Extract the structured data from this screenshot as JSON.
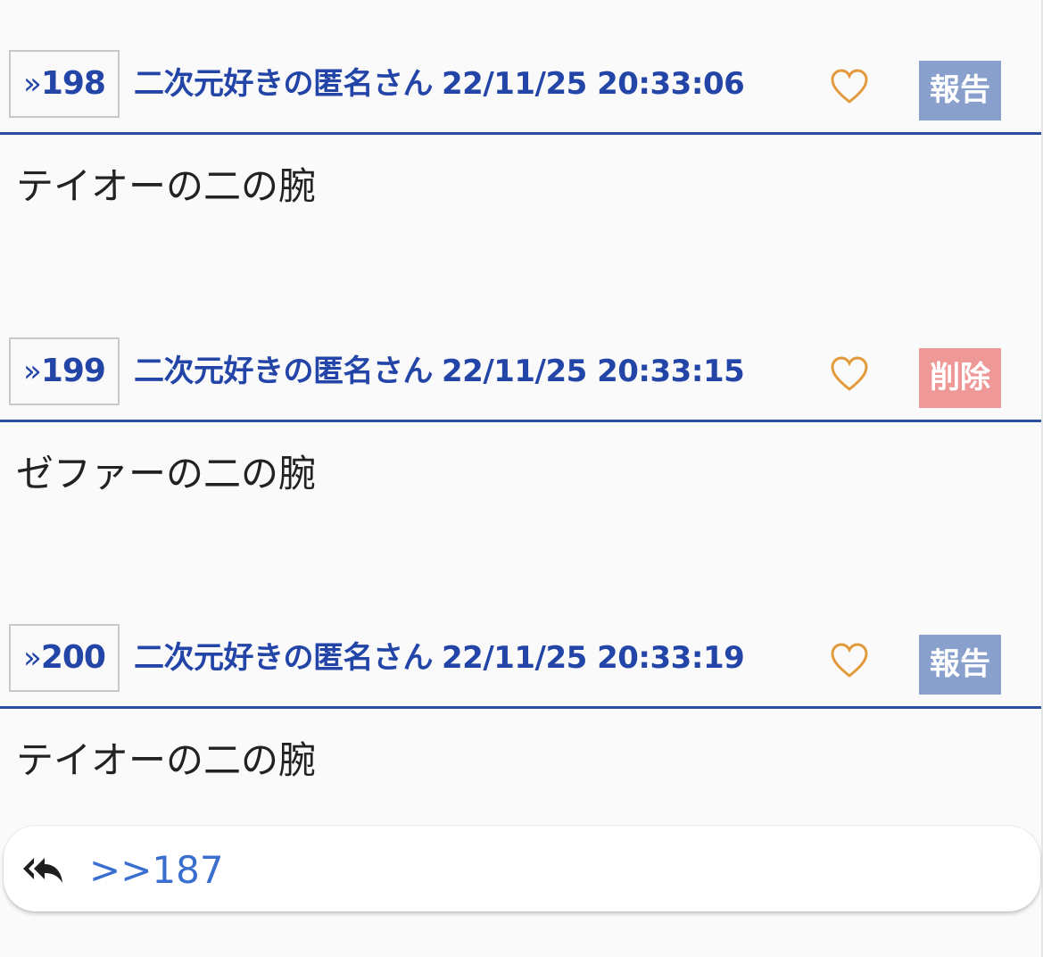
{
  "posts": [
    {
      "number": "198",
      "author": "二次元好きの匿名さん",
      "datetime": "22/11/25 20:33:06",
      "action": "報告",
      "body": "テイオーの二の腕"
    },
    {
      "number": "199",
      "author": "二次元好きの匿名さん",
      "datetime": "22/11/25 20:33:15",
      "action": "削除",
      "body": "ゼファーの二の腕"
    },
    {
      "number": "200",
      "author": "二次元好きの匿名さん",
      "datetime": "22/11/25 20:33:19",
      "action": "報告",
      "body": "テイオーの二の腕"
    }
  ],
  "reply": {
    "link_text": ">>187",
    "icon": "reply-all-icon"
  },
  "icons": {
    "anchor": "double-chevron-icon",
    "like": "heart-icon"
  },
  "colors": {
    "accent": "#2445a8",
    "report_button": "#8aa0cc",
    "delete_button": "#ef9898",
    "heart": "#e39a3c",
    "reply_link": "#3a6fcf"
  }
}
